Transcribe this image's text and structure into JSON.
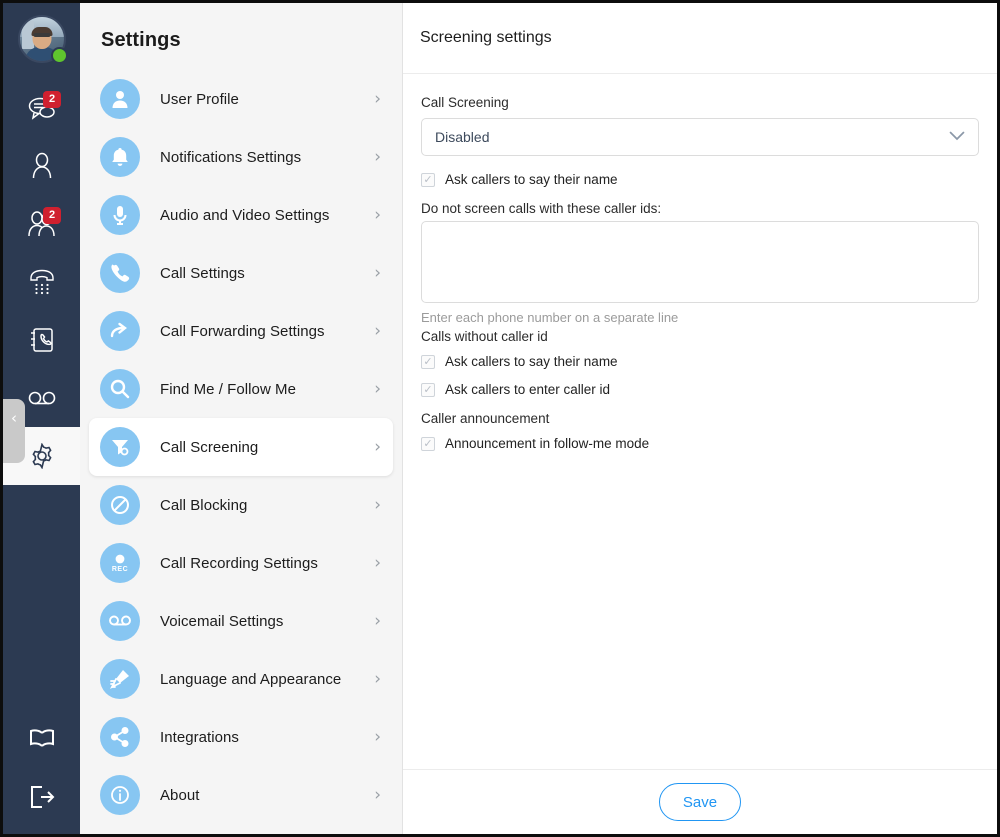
{
  "rail": {
    "avatar": {
      "name": "avatar",
      "presence": "online"
    },
    "items": [
      {
        "icon": "chat-icon",
        "badge": "2",
        "active": false
      },
      {
        "icon": "contact-person-icon",
        "badge": "",
        "active": false
      },
      {
        "icon": "contacts-group-icon",
        "badge": "2",
        "active": false
      },
      {
        "icon": "dialpad-phone-icon",
        "badge": "",
        "active": false
      },
      {
        "icon": "call-history-book-icon",
        "badge": "",
        "active": false
      },
      {
        "icon": "voicemail-icon",
        "badge": "",
        "active": false
      },
      {
        "icon": "gear-icon",
        "badge": "",
        "active": true
      }
    ],
    "bottom_items": [
      {
        "icon": "book-icon"
      },
      {
        "icon": "logout-icon"
      }
    ],
    "collapse_glyph": "‹"
  },
  "menu": {
    "title": "Settings",
    "chevron": "›",
    "items": [
      {
        "label": "User Profile",
        "icon": "user-profile-icon",
        "selected": false
      },
      {
        "label": "Notifications Settings",
        "icon": "bell-icon",
        "selected": false
      },
      {
        "label": "Audio and Video Settings",
        "icon": "microphone-icon",
        "selected": false
      },
      {
        "label": "Call Settings",
        "icon": "phone-handset-icon",
        "selected": false
      },
      {
        "label": "Call Forwarding Settings",
        "icon": "forward-arrow-icon",
        "selected": false
      },
      {
        "label": "Find Me / Follow Me",
        "icon": "magnifier-icon",
        "selected": false
      },
      {
        "label": "Call Screening",
        "icon": "funnel-icon",
        "selected": true
      },
      {
        "label": "Call Blocking",
        "icon": "block-icon",
        "selected": false
      },
      {
        "label": "Call Recording Settings",
        "icon": "record-icon",
        "selected": false
      },
      {
        "label": "Voicemail Settings",
        "icon": "voicemail-icon",
        "selected": false
      },
      {
        "label": "Language and Appearance",
        "icon": "paintbrush-icon",
        "selected": false
      },
      {
        "label": "Integrations",
        "icon": "share-icon",
        "selected": false
      },
      {
        "label": "About",
        "icon": "info-icon",
        "selected": false
      }
    ]
  },
  "content": {
    "header_title": "Screening settings",
    "call_screening_label": "Call Screening",
    "call_screening_value": "Disabled",
    "call_screening_options": [
      "Disabled"
    ],
    "select_chevron": "⌄",
    "ask_name_label": "Ask callers to say their name",
    "ask_name_checked": true,
    "whitelist_label": "Do not screen calls with these caller ids:",
    "whitelist_value": "",
    "whitelist_placeholder": "",
    "whitelist_helper": "Enter each phone number on a separate line",
    "no_caller_id_heading": "Calls without caller id",
    "no_caller_id_ask_name_label": "Ask callers to say their name",
    "no_caller_id_ask_name_checked": true,
    "no_caller_id_enter_id_label": "Ask callers to enter caller id",
    "no_caller_id_enter_id_checked": true,
    "announcement_heading": "Caller announcement",
    "announcement_follow_me_label": "Announcement in follow-me mode",
    "announcement_follow_me_checked": true,
    "checkbox_tick": "✓",
    "save_label": "Save"
  },
  "colors": {
    "rail_bg": "#2c3a52",
    "menu_bg": "#f5f5f5",
    "icon_circle": "#87c6f2",
    "accent": "#2196f3",
    "badge": "#d0202f",
    "presence_online": "#5fc52e"
  }
}
